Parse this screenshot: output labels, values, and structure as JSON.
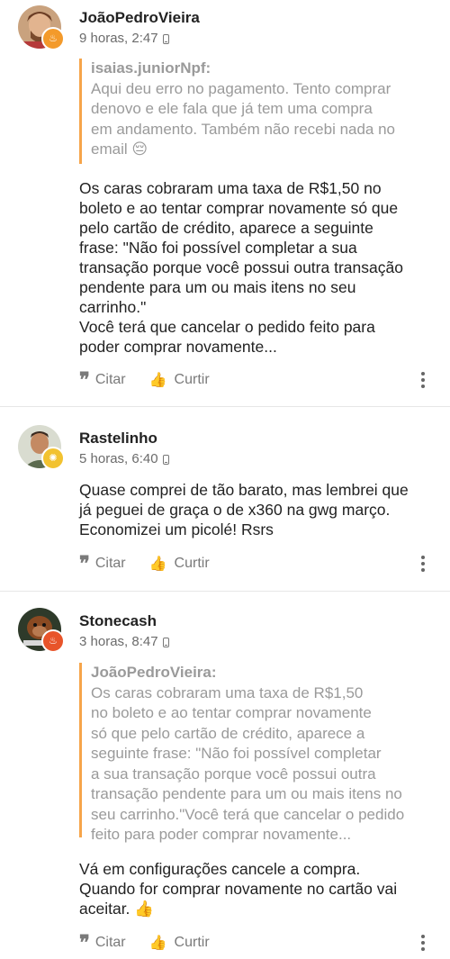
{
  "posts": [
    {
      "author": "JoãoPedroVieira",
      "time": "9 horas, 2:47",
      "avatar_icon": "user-avatar-icon",
      "badge_icon": "flame-badge-icon",
      "badge_color": "#f39a2b",
      "quote": {
        "author": "isaias.juniorNpf:",
        "lines": [
          "Aqui  deu erro no pagamento. Tento comprar",
          "denovo e ele fala que já tem uma compra",
          "em andamento. Também não recebi nada no",
          "email 😔"
        ]
      },
      "body_lines": [
        "Os caras cobraram uma taxa de R$1,50 no",
        "boleto e ao tentar comprar novamente só que",
        "pelo cartão de crédito, aparece a seguinte",
        "frase: \"Não foi possível completar a sua",
        "transação porque você possui outra transação",
        "pendente para um ou mais itens no seu",
        "carrinho.\"",
        "Você terá que cancelar o pedido feito para",
        "poder comprar novamente..."
      ],
      "actions": {
        "quote": "Citar",
        "like": "Curtir"
      }
    },
    {
      "author": "Rastelinho",
      "time": "5 horas, 6:40",
      "avatar_icon": "user-avatar-icon",
      "badge_icon": "sun-badge-icon",
      "badge_color": "#f2c230",
      "body_lines": [
        "Quase comprei de tão barato, mas lembrei que",
        "já peguei de graça o de x360 na gwg março.",
        "Economizei um picolé! Rsrs"
      ],
      "actions": {
        "quote": "Citar",
        "like": "Curtir"
      }
    },
    {
      "author": "Stonecash",
      "time": "3 horas, 8:47",
      "avatar_icon": "user-avatar-icon",
      "badge_icon": "flame-badge-icon",
      "badge_color": "#e8542a",
      "quote": {
        "author": "JoãoPedroVieira:",
        "lines": [
          "Os caras cobraram uma taxa de R$1,50",
          "no boleto e ao tentar comprar novamente",
          "só que pelo cartão de crédito, aparece a",
          "seguinte frase: \"Não foi possível completar",
          "a sua transação porque você possui outra",
          "transação pendente para um ou mais itens no",
          "seu carrinho.\"Você terá que cancelar o pedido",
          "feito para poder comprar novamente..."
        ]
      },
      "body_lines": [
        "Vá em configurações cancele a compra.",
        "Quando for comprar novamente no cartão vai",
        "aceitar. 👍"
      ],
      "actions": {
        "quote": "Citar",
        "like": "Curtir"
      }
    }
  ],
  "icons": {
    "quote": "quote-icon",
    "like": "thumbs-up-icon",
    "device": "phone-icon",
    "more": "more-vertical-icon"
  }
}
